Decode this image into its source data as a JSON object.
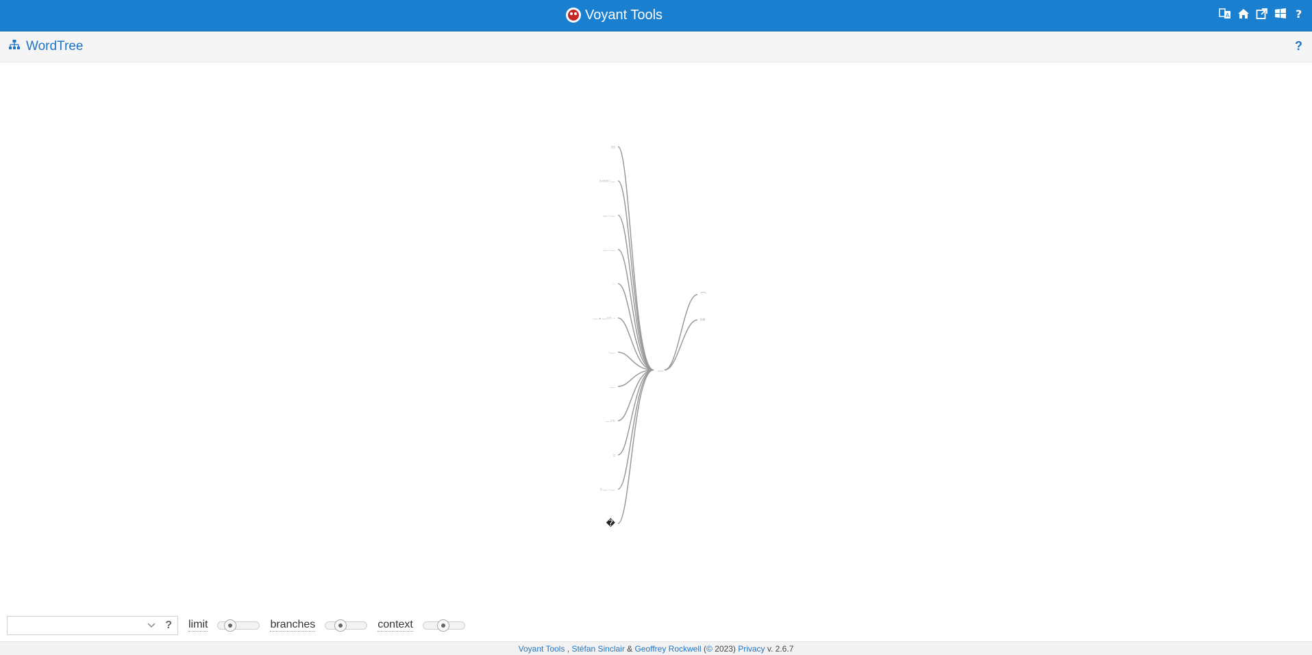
{
  "app": {
    "title": "Voyant Tools",
    "top_icons": [
      "translate-icon",
      "home-icon",
      "external-link-icon",
      "windows-icon",
      "help-icon"
    ],
    "accent_color": "#1a7fcf"
  },
  "panel": {
    "title": "WordTree",
    "title_icon": "sitemap-icon",
    "help_label": "?"
  },
  "tree": {
    "root_glyph": "—",
    "left_leaves": [
      "ᵍᵍ",
      "ᵇᵈᵇᵇˡ—",
      "—·—",
      "—·—",
      "◦",
      "—•—ᵇᵇ·ˑ",
      "ᵎ—",
      "—",
      "—ᵇᵇ",
      "ᵍ",
      "ᵇ—ˑ—",
      "�"
    ],
    "right_leaves": [
      "⌒",
      "ᵇᵇ"
    ]
  },
  "toolbar": {
    "search_value": "",
    "search_placeholder": "",
    "help_label": "?",
    "limit_label": "limit",
    "branches_label": "branches",
    "context_label": "context",
    "limit_level": 0.2,
    "branches_level": 0.3,
    "context_level": 0.45
  },
  "footer": {
    "link_voyant": "Voyant Tools",
    "sep1": " , ",
    "link_sinclair": "Stéfan Sinclair",
    "amp": " & ",
    "link_rockwell": "Geoffrey Rockwell",
    "copyright_open": " (",
    "copyright_sym": "©",
    "copyright_year": " 2023) ",
    "link_privacy": "Privacy",
    "version": " v. 2.6.7"
  }
}
